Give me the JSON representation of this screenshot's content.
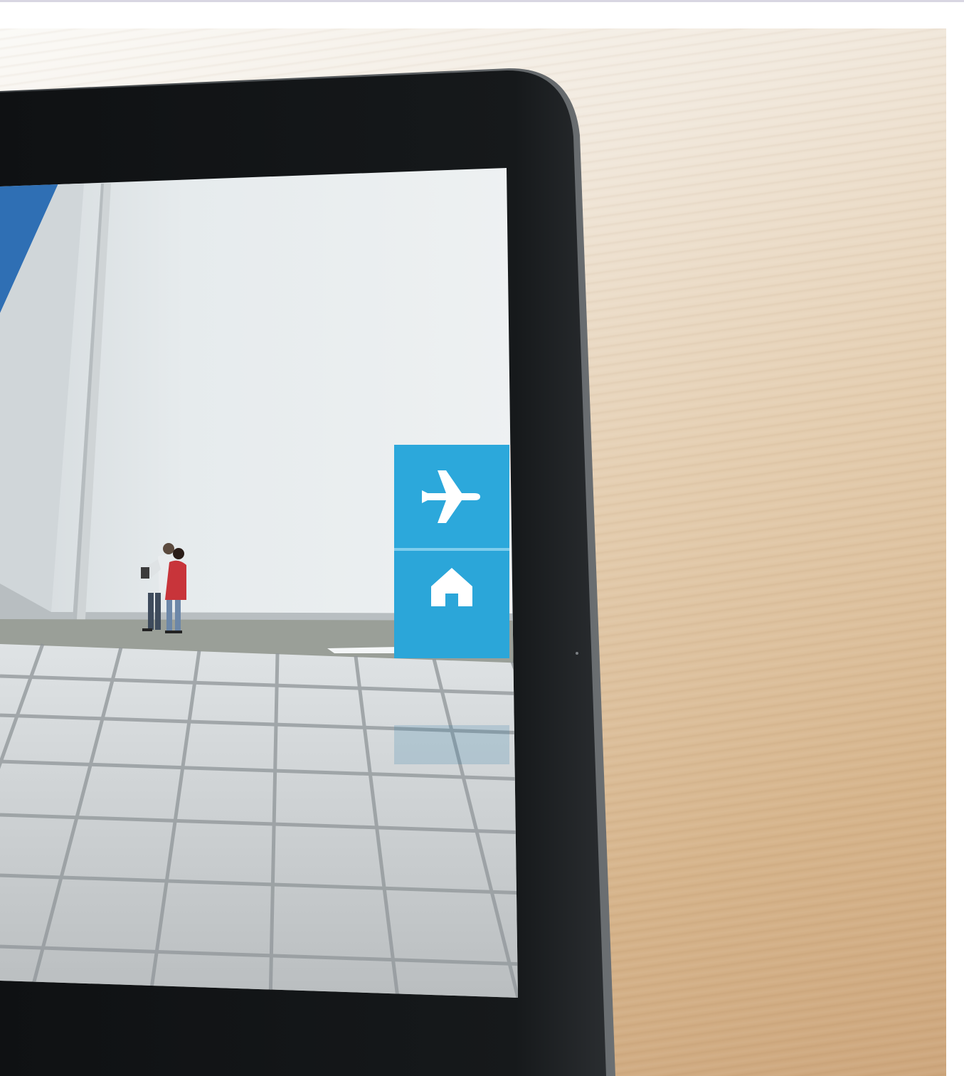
{
  "scene": {
    "device": "tablet-in-landscape",
    "surface": "wooden-desk"
  },
  "app_screen": {
    "view": "augmented-reality-architecture",
    "side_menu": [
      {
        "name": "flight-button",
        "icon": "airplane-icon"
      },
      {
        "name": "home-button",
        "icon": "home-icon"
      }
    ]
  },
  "colors": {
    "accent": "#2ca8db",
    "bezel": "#121416",
    "wall": "#e3e8ea",
    "floor_tiles": "#c9cdd0",
    "desk": "#d9b993"
  }
}
